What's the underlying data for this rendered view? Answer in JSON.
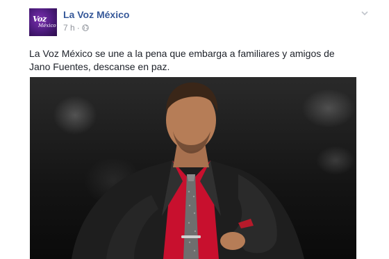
{
  "post": {
    "page_name": "La Voz México",
    "time": "7 h",
    "separator": "·",
    "privacy_icon": "globe-icon",
    "menu_icon": "chevron-down-icon",
    "message": "La Voz México se une a la pena que embarga a familiares y amigos de Jano Fuentes, descanse en paz.",
    "avatar": {
      "logo_text_top": "Voz",
      "logo_text_bottom": "México"
    }
  },
  "colors": {
    "link": "#365899",
    "meta": "#90949c",
    "text": "#1d2129",
    "avatar_purple": "#4a1a7a",
    "shirt_red": "#c8102e"
  }
}
